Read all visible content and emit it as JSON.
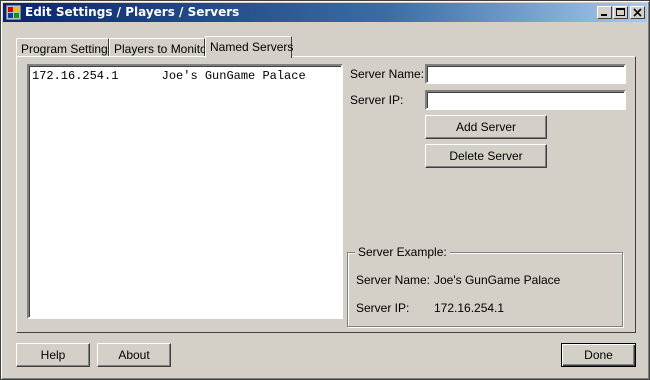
{
  "window": {
    "title": "Edit Settings / Players / Servers",
    "titlebar_colors": {
      "start": "#0a246a",
      "end": "#a6caf0"
    }
  },
  "tabs": [
    {
      "label": "Program Settings",
      "active": false
    },
    {
      "label": "Players to Monitor",
      "active": false
    },
    {
      "label": "Named Servers",
      "active": true
    }
  ],
  "named_servers": {
    "list": [
      {
        "ip": "172.16.254.1",
        "name": "Joe's GunGame Palace"
      }
    ],
    "server_name_label": "Server Name:",
    "server_name_value": "",
    "server_ip_label": "Server IP:",
    "server_ip_value": "",
    "add_button": "Add Server",
    "delete_button": "Delete Server",
    "example": {
      "legend": "Server Example:",
      "name_label": "Server Name:",
      "name_value": "Joe's GunGame Palace",
      "ip_label": "Server IP:",
      "ip_value": "172.16.254.1"
    }
  },
  "footer": {
    "help_button": "Help",
    "about_button": "About",
    "done_button": "Done"
  }
}
